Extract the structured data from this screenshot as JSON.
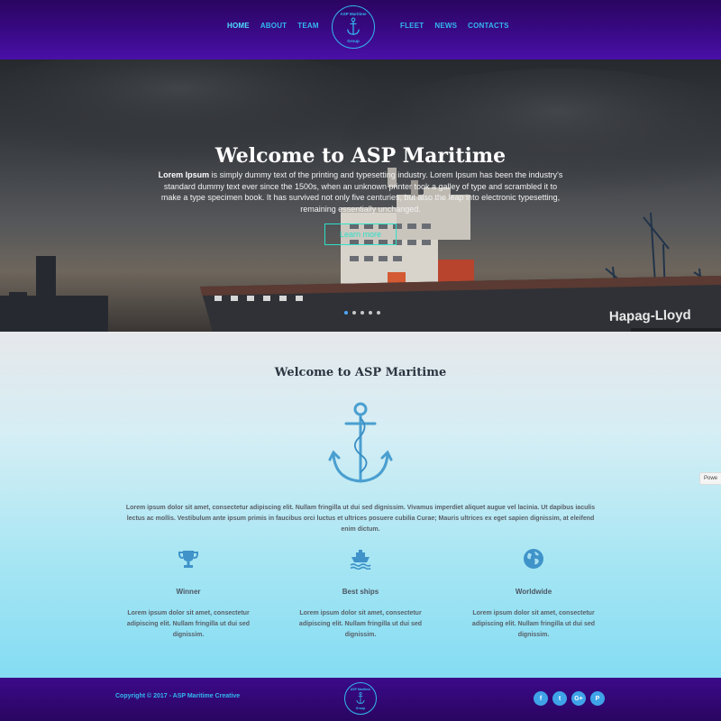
{
  "nav": {
    "left": [
      {
        "label": "HOME",
        "active": true
      },
      {
        "label": "ABOUT",
        "active": false
      },
      {
        "label": "TEAM",
        "active": false
      }
    ],
    "right": [
      {
        "label": "FLEET",
        "active": false
      },
      {
        "label": "NEWS",
        "active": false
      },
      {
        "label": "CONTACTS",
        "active": false
      }
    ]
  },
  "logo": {
    "top_text": "ASP Maritime",
    "bottom_text": "Group"
  },
  "hero": {
    "title": "Welcome to ASP Maritime",
    "text_bold": "Lorem Ipsum",
    "text": " is simply dummy text of the printing and typesetting industry. Lorem Ipsum has been the industry's standard dummy text ever since the 1500s, when an unknown printer took a galley of type and scrambled it to make a type specimen book. It has survived not only five centuries, but also the leap into electronic typesetting, remaining essentially unchanged.",
    "button": "Learn more",
    "ship_label": "Hapag-Lloyd",
    "slides": 5,
    "active_slide": 0
  },
  "content": {
    "title": "Welcome to ASP Maritime",
    "paragraph": "Lorem ipsum dolor sit amet, consectetur adipiscing elit. Nullam fringilla ut dui sed dignissim. Vivamus imperdiet aliquet augue vel lacinia. Ut dapibus iaculis lectus ac mollis. Vestibulum ante ipsum primis in faucibus orci luctus et ultrices posuere cubilia Curae; Mauris ultrices ex eget sapien dignissim, at eleifend enim dictum.",
    "features": [
      {
        "icon": "trophy-icon",
        "title": "Winner",
        "text": "Lorem ipsum dolor sit amet, consectetur adipiscing elit. Nullam fringilla ut dui sed dignissim."
      },
      {
        "icon": "ship-icon",
        "title": "Best ships",
        "text": "Lorem ipsum dolor sit amet, consectetur adipiscing elit. Nullam fringilla ut dui sed dignissim."
      },
      {
        "icon": "globe-icon",
        "title": "Worldwide",
        "text": "Lorem ipsum dolor sit amet, consectetur adipiscing elit. Nullam fringilla ut dui sed dignissim."
      }
    ]
  },
  "side_tab": "Powe",
  "footer": {
    "copyright": "Copyright © 2017 - ASP Maritime Creative",
    "socials": [
      {
        "icon": "facebook-icon",
        "glyph": "f"
      },
      {
        "icon": "twitter-icon",
        "glyph": "t"
      },
      {
        "icon": "google-plus-icon",
        "glyph": "G+"
      },
      {
        "icon": "pinterest-icon",
        "glyph": "P"
      }
    ]
  },
  "colors": {
    "accent": "#33b8f0",
    "header_bg": "#3b0a8a",
    "button": "#2fe0c8"
  }
}
